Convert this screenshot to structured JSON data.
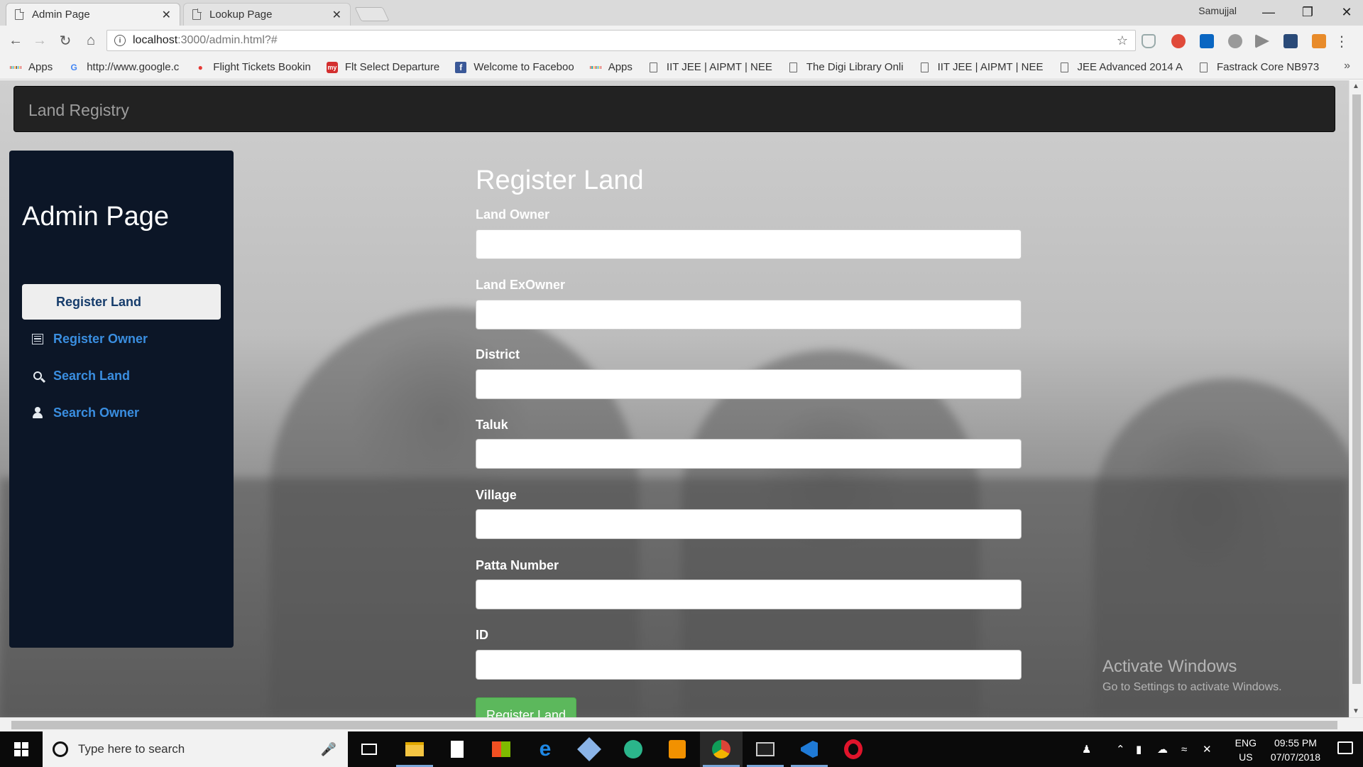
{
  "browser": {
    "tabs": [
      {
        "title": "Admin Page",
        "close": "✕"
      },
      {
        "title": "Lookup Page",
        "close": "✕"
      }
    ],
    "window_user": "Samujjal",
    "address": {
      "host": "localhost",
      "path": ":3000/admin.html?#"
    },
    "bookmarks": [
      {
        "label": "Apps"
      },
      {
        "label": "http://www.google.c"
      },
      {
        "label": "Flight Tickets Bookin"
      },
      {
        "label": "Flt Select Departure"
      },
      {
        "label": "Welcome to Faceboo"
      },
      {
        "label": "Apps"
      },
      {
        "label": "IIT JEE | AIPMT | NEE"
      },
      {
        "label": "The Digi Library Onli"
      },
      {
        "label": "IIT JEE | AIPMT | NEE"
      },
      {
        "label": "JEE Advanced 2014 A"
      },
      {
        "label": "Fastrack Core NB973"
      }
    ],
    "more": "»"
  },
  "navbar": {
    "brand": "Land Registry"
  },
  "sidebar": {
    "title": "Admin Page",
    "items": [
      {
        "label": "Register Land",
        "icon": "th-icon",
        "active": true
      },
      {
        "label": "Register Owner",
        "icon": "list-icon",
        "active": false
      },
      {
        "label": "Search Land",
        "icon": "search-icon",
        "active": false
      },
      {
        "label": "Search Owner",
        "icon": "user-icon",
        "active": false
      }
    ]
  },
  "form": {
    "title": "Register Land",
    "fields": [
      {
        "label": "Land Owner",
        "value": ""
      },
      {
        "label": "Land ExOwner",
        "value": ""
      },
      {
        "label": "District",
        "value": ""
      },
      {
        "label": "Taluk",
        "value": ""
      },
      {
        "label": "Village",
        "value": ""
      },
      {
        "label": "Patta Number",
        "value": ""
      },
      {
        "label": "ID",
        "value": ""
      }
    ],
    "submit_label": "Register Land"
  },
  "watermark": {
    "line1": "Activate Windows",
    "line2": "Go to Settings to activate Windows."
  },
  "taskbar": {
    "search_placeholder": "Type here to search",
    "lang_top": "ENG",
    "lang_bottom": "US",
    "time": "09:55 PM",
    "date": "07/07/2018"
  }
}
